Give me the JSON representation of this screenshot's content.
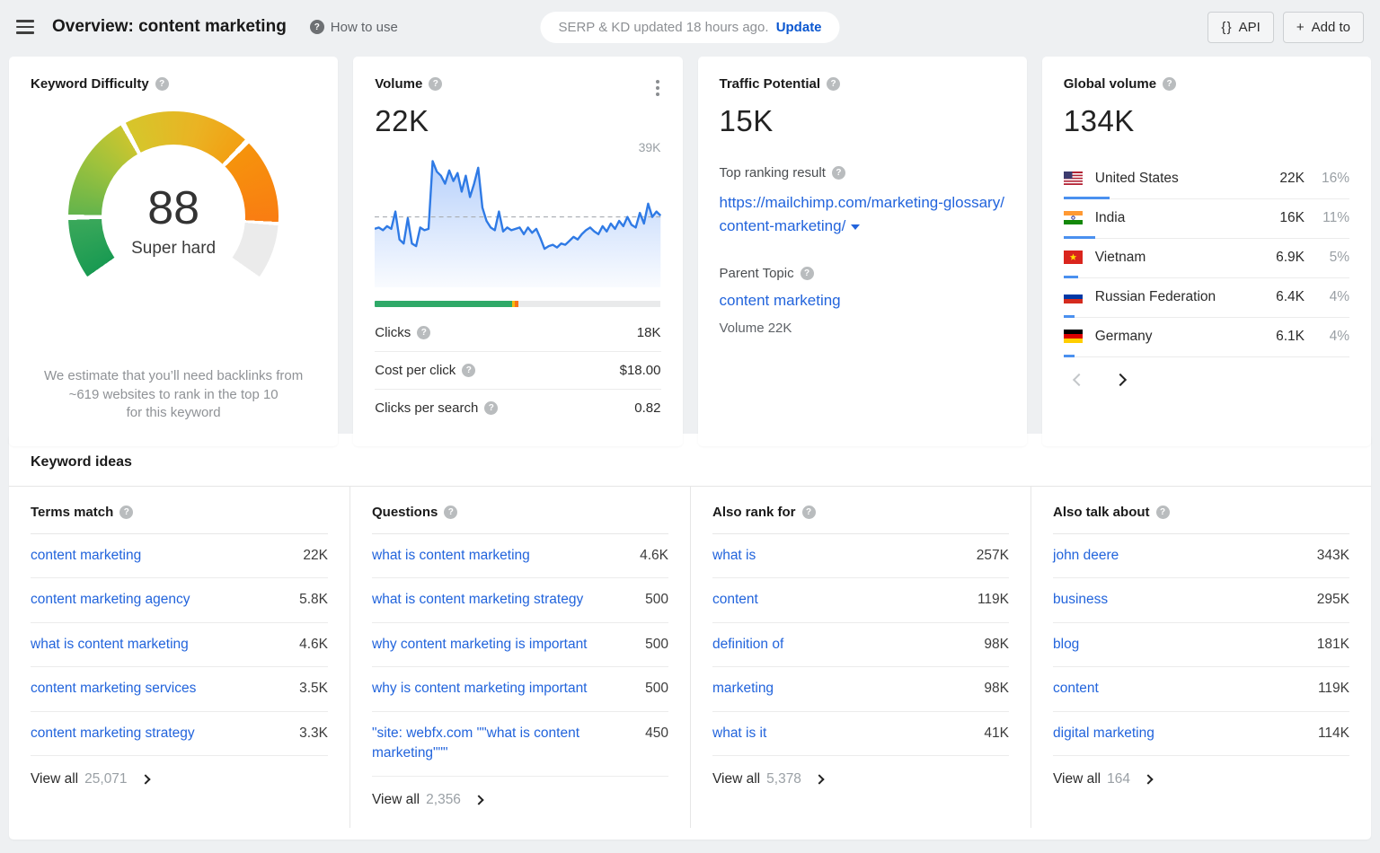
{
  "header": {
    "title": "Overview: content marketing",
    "how_to_use": "How to use",
    "serp_status": "SERP & KD updated 18 hours ago.",
    "update_label": "Update",
    "api_label": "API",
    "add_to_label": "Add to"
  },
  "cards": {
    "keyword_difficulty": {
      "title": "Keyword Difficulty",
      "value": "88",
      "level": "Super hard",
      "note": "We estimate that you’ll need backlinks from\n~619 websites to rank in the top 10\nfor this keyword"
    },
    "volume": {
      "title": "Volume",
      "value": "22K",
      "peak_label": "39K",
      "metrics": [
        {
          "label": "Clicks",
          "value": "18K"
        },
        {
          "label": "Cost per click",
          "value": "$18.00"
        },
        {
          "label": "Clicks per search",
          "value": "0.82"
        }
      ]
    },
    "traffic_potential": {
      "title": "Traffic Potential",
      "value": "15K",
      "top_ranking_label": "Top ranking result",
      "url": "https://mailchimp.com/marketing-glossary/content-marketing/",
      "parent_topic_label": "Parent Topic",
      "parent_topic": "content marketing",
      "parent_volume": "Volume 22K"
    },
    "global_volume": {
      "title": "Global volume",
      "value": "134K",
      "countries": [
        {
          "code": "us",
          "name": "United States",
          "volume": "22K",
          "percent": "16%",
          "bar": 16
        },
        {
          "code": "in",
          "name": "India",
          "volume": "16K",
          "percent": "11%",
          "bar": 11
        },
        {
          "code": "vn",
          "name": "Vietnam",
          "volume": "6.9K",
          "percent": "5%",
          "bar": 5
        },
        {
          "code": "ru",
          "name": "Russian Federation",
          "volume": "6.4K",
          "percent": "4%",
          "bar": 4
        },
        {
          "code": "de",
          "name": "Germany",
          "volume": "6.1K",
          "percent": "4%",
          "bar": 4
        }
      ]
    }
  },
  "keyword_ideas": {
    "title": "Keyword ideas",
    "view_all_label": "View all",
    "columns": [
      {
        "title": "Terms match",
        "rows": [
          {
            "keyword": "content marketing",
            "volume": "22K"
          },
          {
            "keyword": "content marketing agency",
            "volume": "5.8K"
          },
          {
            "keyword": "what is content marketing",
            "volume": "4.6K"
          },
          {
            "keyword": "content marketing services",
            "volume": "3.5K"
          },
          {
            "keyword": "content marketing strategy",
            "volume": "3.3K"
          }
        ],
        "view_all_count": "25,071"
      },
      {
        "title": "Questions",
        "rows": [
          {
            "keyword": "what is content marketing",
            "volume": "4.6K"
          },
          {
            "keyword": "what is content marketing strategy",
            "volume": "500"
          },
          {
            "keyword": "why content marketing is important",
            "volume": "500"
          },
          {
            "keyword": "why is content marketing important",
            "volume": "500"
          },
          {
            "keyword": "\"site: webfx.com \"\"what is content marketing\"\"\"",
            "volume": "450"
          }
        ],
        "view_all_count": "2,356"
      },
      {
        "title": "Also rank for",
        "rows": [
          {
            "keyword": "what is",
            "volume": "257K"
          },
          {
            "keyword": "content",
            "volume": "119K"
          },
          {
            "keyword": "definition of",
            "volume": "98K"
          },
          {
            "keyword": "marketing",
            "volume": "98K"
          },
          {
            "keyword": "what is it",
            "volume": "41K"
          }
        ],
        "view_all_count": "5,378"
      },
      {
        "title": "Also talk about",
        "rows": [
          {
            "keyword": "john deere",
            "volume": "343K"
          },
          {
            "keyword": "business",
            "volume": "295K"
          },
          {
            "keyword": "blog",
            "volume": "181K"
          },
          {
            "keyword": "content",
            "volume": "119K"
          },
          {
            "keyword": "digital marketing",
            "volume": "114K"
          }
        ],
        "view_all_count": "164"
      }
    ]
  },
  "chart_data": [
    {
      "type": "gauge",
      "title": "Keyword Difficulty",
      "value": 88,
      "max": 100,
      "label": "Super hard",
      "colors": [
        "#199a52",
        "#63b44c",
        "#d6c62b",
        "#f2a013",
        "#f97d12",
        "#ebebeb"
      ]
    },
    {
      "type": "area",
      "title": "Volume trend",
      "current_value": 22000,
      "peak_value": 39000,
      "baseline_pct": 53,
      "values": [
        44,
        45,
        43,
        46,
        44,
        57,
        36,
        33,
        52,
        33,
        31,
        45,
        43,
        44,
        95,
        87,
        84,
        78,
        88,
        80,
        86,
        72,
        84,
        68,
        78,
        90,
        60,
        50,
        45,
        43,
        57,
        42,
        45,
        43,
        44,
        45,
        40,
        45,
        41,
        44,
        37,
        29,
        31,
        32,
        30,
        33,
        32,
        35,
        38,
        36,
        40,
        43,
        45,
        42,
        40,
        46,
        42,
        48,
        44,
        50,
        46,
        53,
        47,
        45,
        56,
        48,
        63,
        53,
        57,
        54
      ]
    },
    {
      "type": "bar",
      "title": "Clicks distribution",
      "segments": [
        {
          "color": "#2fa968",
          "pct": 48
        },
        {
          "color": "#f5b90f",
          "pct": 0.8
        },
        {
          "color": "#f97316",
          "pct": 1.4
        },
        {
          "color": "#e9eaeb",
          "pct": 49.8
        }
      ]
    }
  ],
  "accent_colors": {
    "link_blue": "#2264dc",
    "update_blue": "#0b57d0",
    "country_bar_blue": "#4a90ef"
  }
}
